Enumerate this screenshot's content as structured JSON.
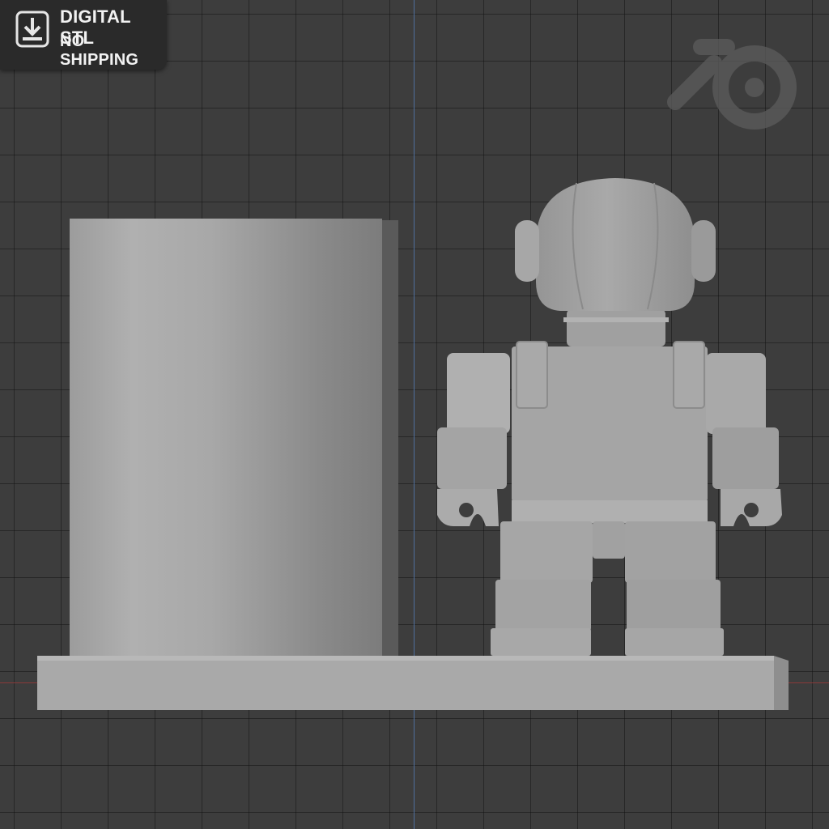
{
  "badge": {
    "line1": "DIGITAL STL",
    "line2": "NO SHIPPING",
    "icon": "download-icon"
  },
  "viewport": {
    "logo_icon": "blender-logo-icon",
    "background_color": "#3d3d3d",
    "grid_color": "#2a2a2a",
    "axis_y_color": "#4f6f9c",
    "axis_x_color": "#8a3a3a",
    "model_color": "#a6a6a6"
  }
}
